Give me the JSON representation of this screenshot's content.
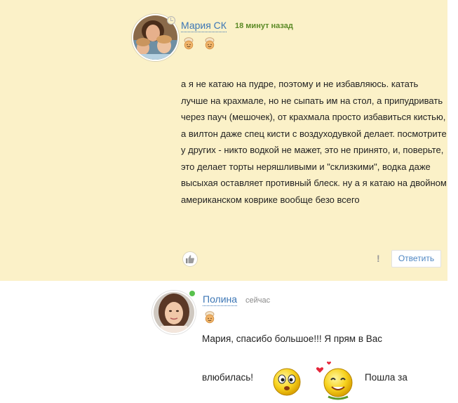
{
  "comment1": {
    "author": "Мария СК",
    "time": "18 минут назад",
    "text": "а я не катаю на пудре, поэтому и не избавляюсь. катать лучше на крахмале, но не сыпать им на стол, а припудривать через пауч (мешочек), от крахмала просто избавиться кистью, а вилтон даже спец кисти с воздуходувкой делает. посмотрите у других - никто водкой не мажет, это не принято, и, поверьте, это делает торты неряшливыми и \"склизкими\", водка даже высыхая оставляет противный блеск. ну а я катаю на двойном американском коврике вообще безо всего",
    "report_label": "!",
    "reply_label": "Ответить"
  },
  "comment2": {
    "author": "Полина",
    "time": "сейчас",
    "text_line1": "Мария, спасибо большое!!! Я прям в Вас",
    "text_line2": "влюбилась!",
    "text_line3": "Пошла за"
  },
  "colors": {
    "highlight_bg": "#fbf1c8",
    "link": "#3c76b5",
    "time_green": "#5b8a25",
    "online": "#58c14d"
  },
  "icons": {
    "like": "thumbs-up-icon",
    "badge": "chef-badge-icon",
    "clock": "clock-icon"
  }
}
